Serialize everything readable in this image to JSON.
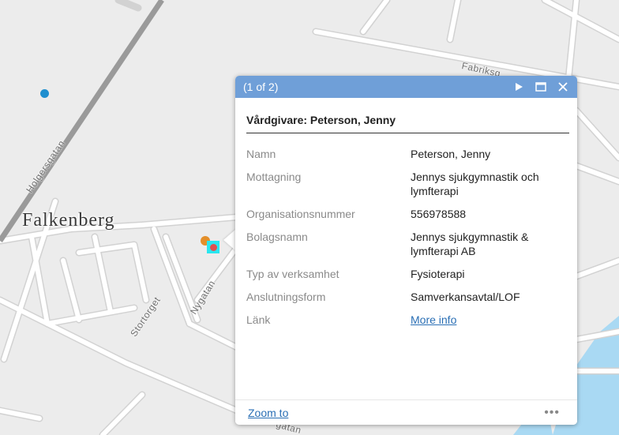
{
  "map": {
    "city_label": "Falkenberg",
    "street_labels": {
      "holgersgatan": "Holgersgatan",
      "fabriksgatan": "Fabriksg",
      "nygatan": "Nygatan",
      "stortorget": "Stortorget",
      "bottom_street": "gatan"
    },
    "colors": {
      "background": "#ececec",
      "road": "#ffffff",
      "road_edge": "#d2d2d2",
      "railway": "#8f8f8f",
      "water": "#a9d9f3",
      "marker_blue": "#1f8fcf",
      "marker_orange": "#e38f2a",
      "marker_red": "#e0504f",
      "selection": "#29e6ef"
    }
  },
  "popup": {
    "counter": "(1 of 2)",
    "title": "Vårdgivare: Peterson, Jenny",
    "icons": {
      "next": "play-next-icon",
      "maximize": "maximize-icon",
      "close": "close-icon"
    },
    "header_color": "#6f9fd8",
    "attributes": [
      {
        "key": "Namn",
        "value": "Peterson, Jenny"
      },
      {
        "key": "Mottagning",
        "value": "Jennys sjukgymnastik och lymfterapi"
      },
      {
        "key": "Organisationsnummer",
        "value": "556978588"
      },
      {
        "key": "Bolagsnamn",
        "value": "Jennys sjukgymnastik & lymfterapi AB"
      },
      {
        "key": "Typ av verksamhet",
        "value": "Fysioterapi"
      },
      {
        "key": "Anslutningsform",
        "value": "Samverkansavtal/LOF"
      },
      {
        "key": "Länk",
        "value": "More info"
      }
    ],
    "footer": {
      "zoom_to": "Zoom to",
      "more": "•••"
    }
  }
}
